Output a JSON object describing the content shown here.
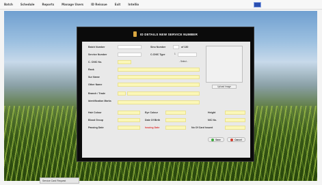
{
  "menubar": {
    "items": [
      "Batch",
      "Schedule",
      "Reports",
      "Manage Users",
      "ID Reissue",
      "Exit",
      "Intellio"
    ]
  },
  "colors": {
    "dialog_bg": "#0b0b0b",
    "form_bg": "#e9e9e9",
    "input_bg": "#fbf7b8",
    "date_label": "#d33333",
    "save_icon": "#3aaa3a",
    "cancel_icon": "#d23a2a"
  },
  "dialog": {
    "title": "ID DETAILS NEW SERVICE NUMBER",
    "icon": "document-icon"
  },
  "form": {
    "batch_number_label": "Batch Number",
    "batch_number_value": "PAKISTAN 2016",
    "sno_label": "Sino Number",
    "sno_value": "1",
    "sno_total": "of 130",
    "service_number_label": "Service Number",
    "service_number_value": "PAF C3",
    "cnic_type_label": "C.CNIC Type",
    "cnic_type_value": "- Select -",
    "cnic_no_label": "C. CNIC No.",
    "cnic_no_value": "2",
    "rank_label": "Rank",
    "sur_name_label": "Sur Name",
    "other_name_label": "Other Name",
    "branch_label": "Branch / Trade",
    "id_marks_label": "Identification Marks",
    "hair_colour_label": "Hair Colour",
    "eye_colour_label": "Eye Colour",
    "height_label": "Height",
    "blood_group_label": "Blood Group",
    "dob_label": "Date Of Birth",
    "nic_no_label": "NIC No.",
    "passing_date_label": "Passing Date",
    "issue_date_label": "Issuing Date",
    "no_of_card_label": "No Of Card Issued",
    "upload_label": "Upload Image",
    "save_label": "Save",
    "cancel_label": "Cancel"
  },
  "taskbar": {
    "item": "Service Card Request"
  }
}
